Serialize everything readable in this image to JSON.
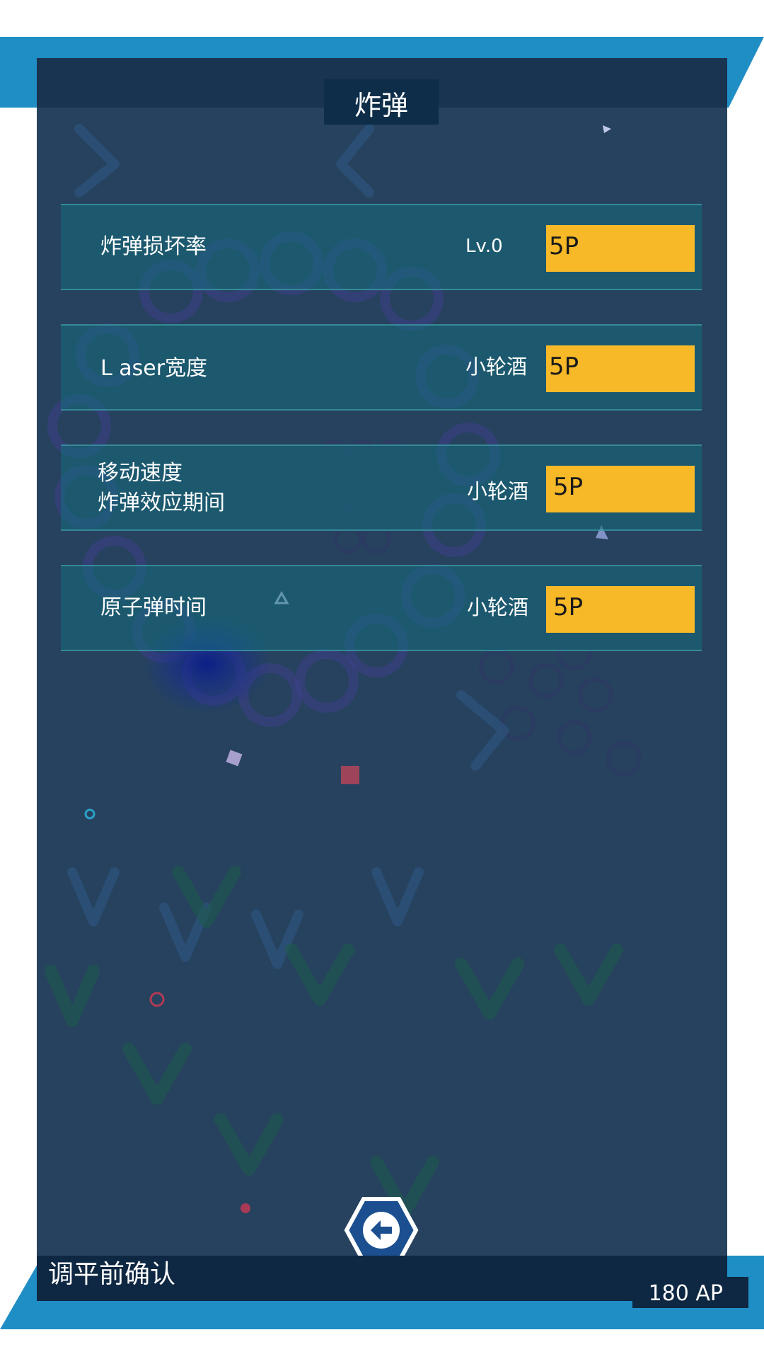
{
  "header": {
    "title": "炸弹"
  },
  "upgrades": [
    {
      "label_lines": [
        "炸弹损坏率"
      ],
      "level": "Lv.0",
      "cost": "5P"
    },
    {
      "label_lines": [
        "L aser宽度"
      ],
      "level": "小轮酒",
      "cost": "5P"
    },
    {
      "label_lines": [
        "移动速度",
        "炸弹效应期间"
      ],
      "level": "小轮酒",
      "cost": "5P"
    },
    {
      "label_lines": [
        "原子弹时间"
      ],
      "level": "小轮酒",
      "cost": "5P"
    }
  ],
  "footer": {
    "title": "调平前确认",
    "ap": "180 AP"
  },
  "icons": {
    "back": "arrow-left-icon"
  },
  "colors": {
    "accent_stripe": "#1f8ec4",
    "panel": "#26425e",
    "cost_button": "#f7b928",
    "back_button_ring": "#ffffff",
    "back_button_fill": "#1b4f8f"
  }
}
